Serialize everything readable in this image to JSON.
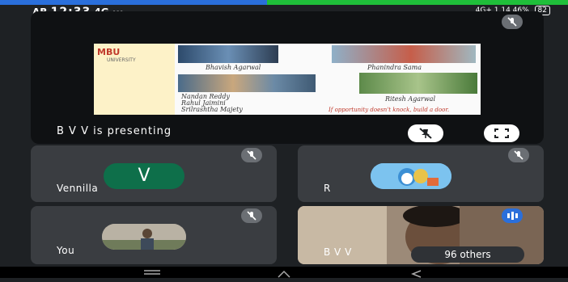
{
  "status_bar": {
    "left_text": "AB",
    "clock": "12:33",
    "extra": "4G ···",
    "right_text": "4G+ 1.14 46%",
    "battery": "82"
  },
  "presentation": {
    "slide": {
      "logo_text": "MBU",
      "logo_sub": "UNIVERSITY",
      "captions": [
        "Bhavish Agarwal",
        "Phanindra Sama",
        "Nandan Reddy\nRahul Jaimini\nSrilrashtha Majety",
        "Ritesh Agarwal"
      ],
      "quote": "If opportunity doesn't knock, build a door."
    },
    "presenting_label": "B V V is presenting"
  },
  "participants": [
    {
      "name": "Vennilla",
      "initial": "V",
      "avatar_color": "#0e6f4a"
    },
    {
      "name": "R"
    },
    {
      "name": "You"
    },
    {
      "name": "B V V",
      "others_label": "96 others"
    }
  ]
}
